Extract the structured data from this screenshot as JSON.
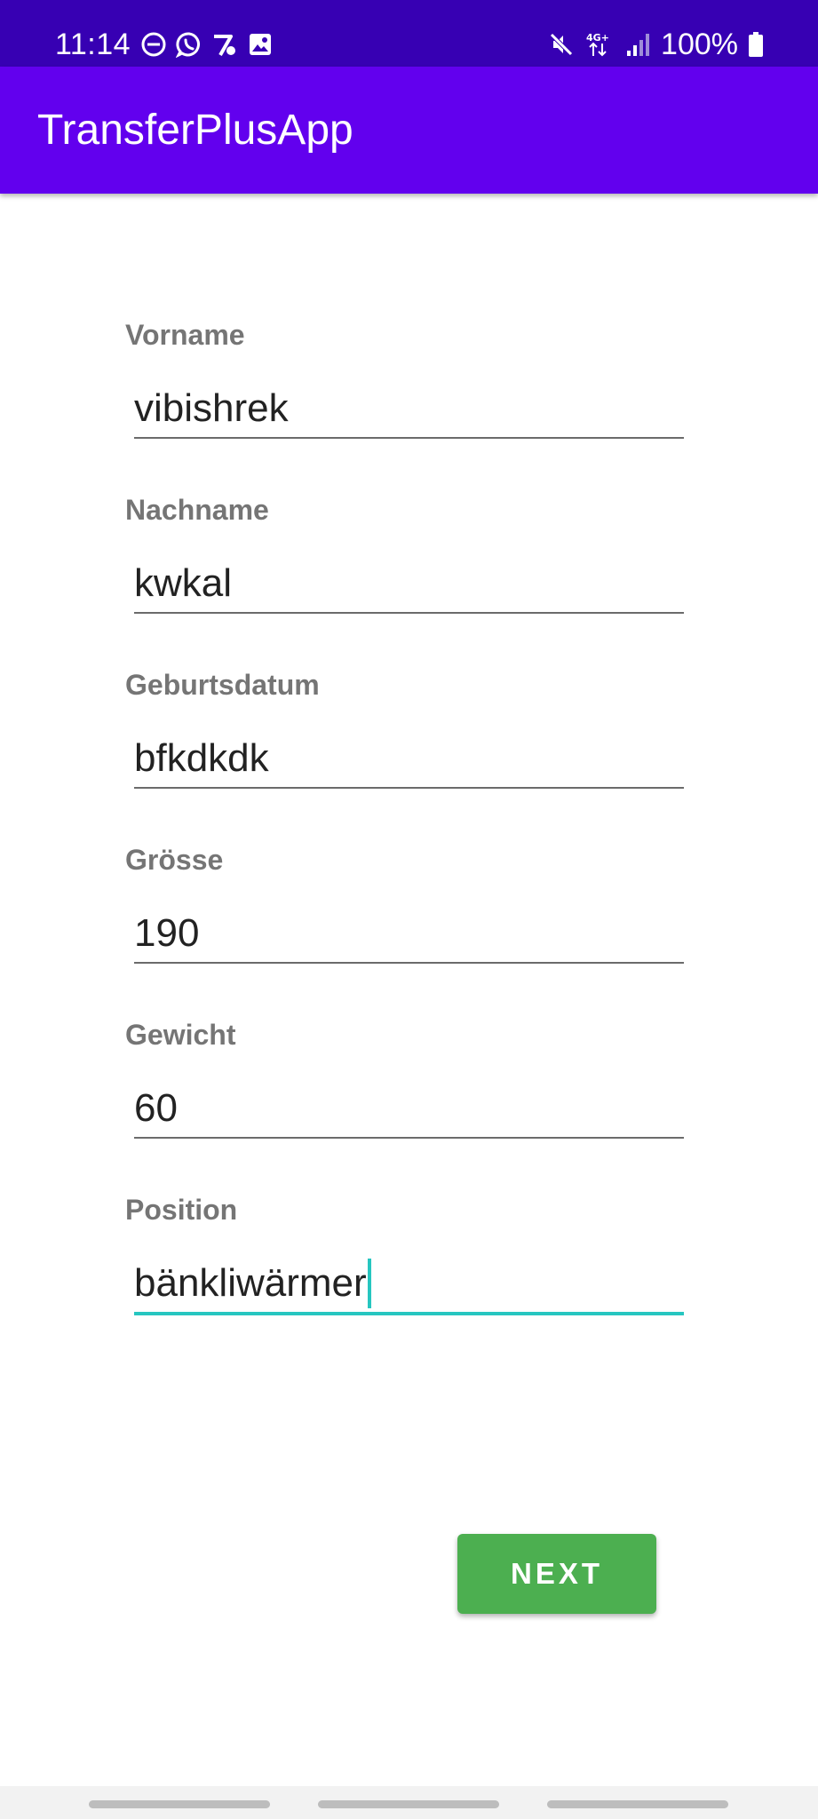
{
  "status_bar": {
    "time": "11:14",
    "battery": "100%",
    "icons_left": [
      "do-not-disturb-icon",
      "whatsapp-icon",
      "app-notification-icon",
      "gallery-icon"
    ],
    "icons_right": [
      "mute-icon",
      "4g-plus-icon",
      "signal-icon",
      "battery-icon"
    ],
    "network_label": "4G+"
  },
  "app_bar": {
    "title": "TransferPlusApp",
    "color": "#6200ee"
  },
  "form": {
    "fields": [
      {
        "label": "Vorname",
        "value": "vibishrek"
      },
      {
        "label": "Nachname",
        "value": "kwkal"
      },
      {
        "label": "Geburtsdatum",
        "value": "bfkdkdk"
      },
      {
        "label": "Grösse",
        "value": "190"
      },
      {
        "label": "Gewicht",
        "value": "60"
      },
      {
        "label": "Position",
        "value": "bänkliwärmer",
        "focused": true
      }
    ],
    "focus_color": "#26c6c0"
  },
  "next_button": {
    "label": "NEXT",
    "color": "#4caf50"
  },
  "status_color": "#3700b3"
}
